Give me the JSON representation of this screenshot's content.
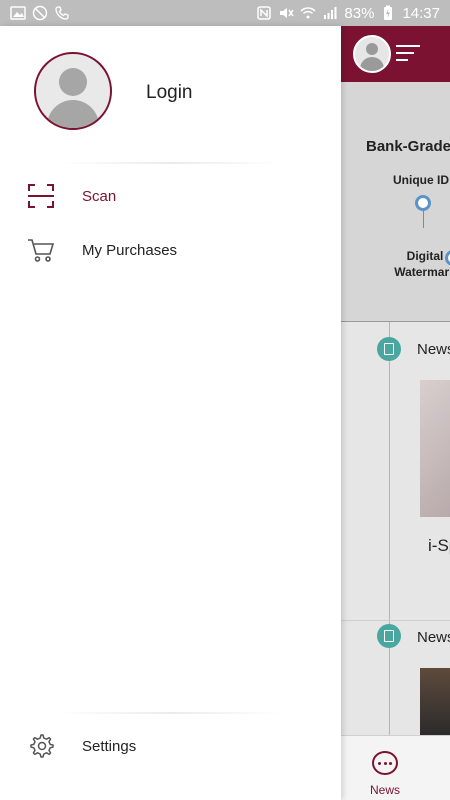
{
  "status_bar": {
    "battery_percent": "83%",
    "time": "14:37"
  },
  "drawer": {
    "login_label": "Login",
    "items": [
      {
        "label": "Scan",
        "icon": "scan-icon"
      },
      {
        "label": "My Purchases",
        "icon": "cart-icon"
      }
    ],
    "settings_label": "Settings"
  },
  "background": {
    "promo_title": "Bank-Grade",
    "promo_label_1": "Unique ID",
    "promo_label_2": "Digital Watermark",
    "news_1": "News",
    "news_2": "News",
    "card_text": "i-Sp",
    "tab_news_label": "News"
  },
  "colors": {
    "accent": "#7b1232",
    "teal": "#49a7a0"
  }
}
